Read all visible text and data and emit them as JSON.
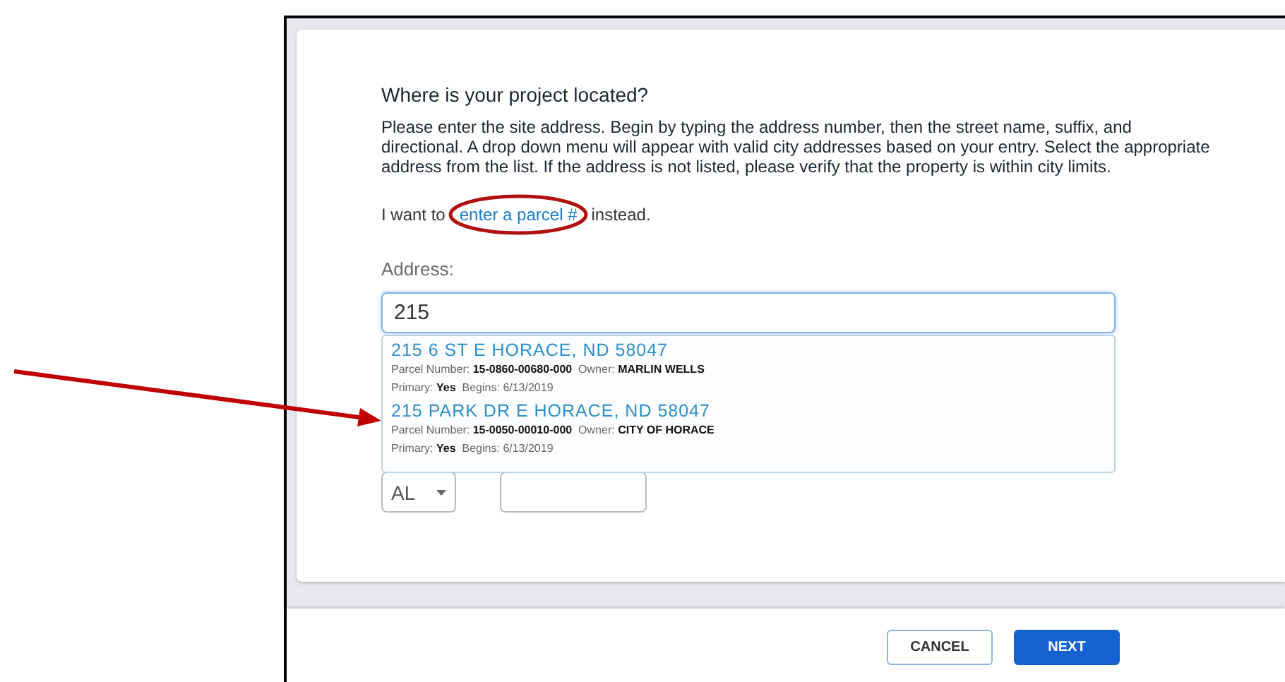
{
  "heading": "Where is your project located?",
  "instructions": "Please enter the site address. Begin by typing the address number, then the street name, suffix, and directional. A drop down menu will appear with valid city addresses based on your entry. Select the appropriate address from the list. If the address is not listed, please verify that the property is within city limits.",
  "parcel_prompt": {
    "before": "I want to",
    "link": "enter a parcel #",
    "after": "instead."
  },
  "address": {
    "label": "Address:",
    "value": "215"
  },
  "suggestions": [
    {
      "address": "215 6 ST E HORACE, ND 58047",
      "parcel_label": "Parcel Number:",
      "parcel": "15-0860-00680-000",
      "owner_label": "Owner:",
      "owner": "MARLIN WELLS",
      "primary_label": "Primary:",
      "primary": "Yes",
      "begins_label": "Begins:",
      "begins": "6/13/2019"
    },
    {
      "address": "215 PARK DR E HORACE, ND 58047",
      "parcel_label": "Parcel Number:",
      "parcel": "15-0050-00010-000",
      "owner_label": "Owner:",
      "owner": "CITY OF HORACE",
      "primary_label": "Primary:",
      "primary": "Yes",
      "begins_label": "Begins:",
      "begins": "6/13/2019"
    }
  ],
  "state_select": {
    "value": "AL"
  },
  "buttons": [
    {
      "label": "CANCEL",
      "kind": "secondary"
    },
    {
      "label": "NEXT",
      "kind": "primary"
    }
  ]
}
